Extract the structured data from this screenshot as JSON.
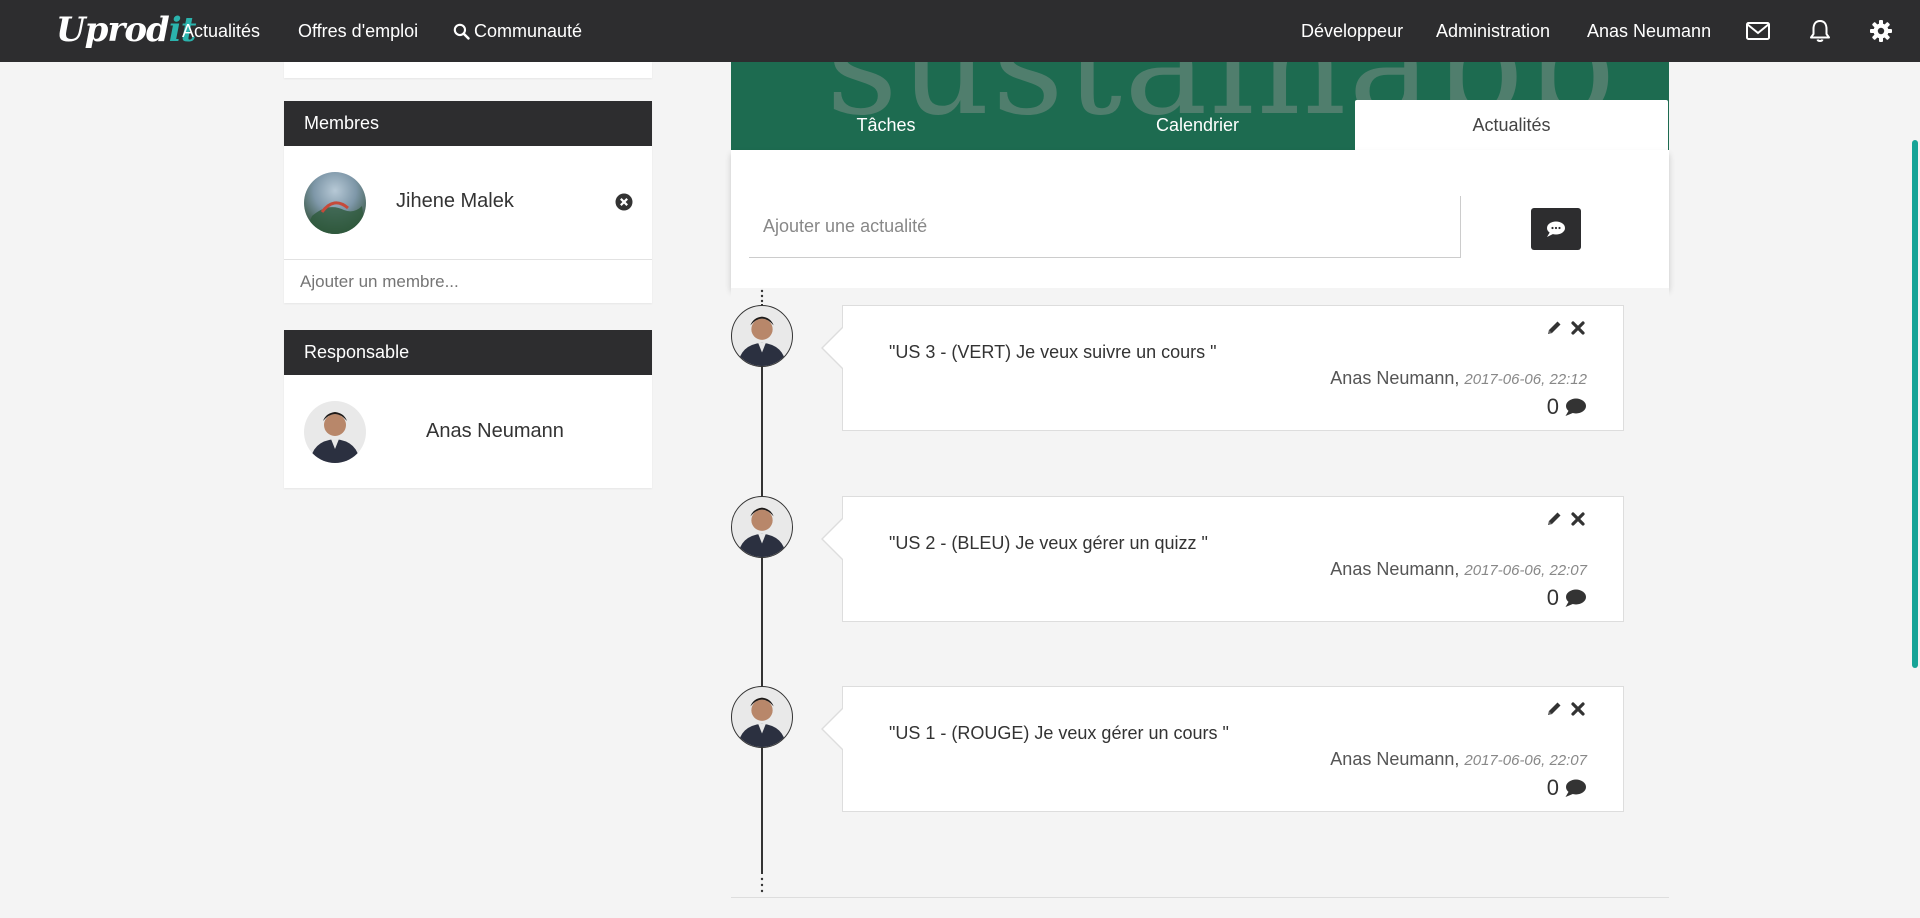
{
  "navbar": {
    "brand_main": "Uprod",
    "brand_accent": "it",
    "links": {
      "actualites": "Actualités",
      "offres": "Offres d'emploi",
      "communaute": "Communauté",
      "developpeur": "Développeur",
      "administration": "Administration",
      "user": "Anas Neumann"
    },
    "icons": [
      "search-icon",
      "envelope-icon",
      "bell-icon",
      "gear-icon"
    ]
  },
  "sidebar": {
    "members": {
      "title": "Membres",
      "items": [
        {
          "name": "Jihene Malek"
        }
      ],
      "add_placeholder": "Ajouter un membre..."
    },
    "responsable": {
      "title": "Responsable",
      "name": "Anas Neumann"
    }
  },
  "project": {
    "banner_text": "sustainapp",
    "tabs": [
      {
        "label": "Tâches",
        "active": false
      },
      {
        "label": "Calendrier",
        "active": false
      },
      {
        "label": "Actualités",
        "active": true
      }
    ]
  },
  "composer": {
    "placeholder": "Ajouter une actualité",
    "send_icon": "comment-icon"
  },
  "posts": [
    {
      "text": "\"US 3 - (VERT) Je veux suivre un cours \"",
      "author": "Anas Neumann,",
      "date": "2017-06-06, 22:12",
      "comments": "0"
    },
    {
      "text": "\"US 2 - (BLEU) Je veux gérer un quizz \"",
      "author": "Anas Neumann,",
      "date": "2017-06-06, 22:07",
      "comments": "0"
    },
    {
      "text": "\"US 1 - (ROUGE) Je veux gérer un cours \"",
      "author": "Anas Neumann,",
      "date": "2017-06-06, 22:07",
      "comments": "0"
    }
  ],
  "colors": {
    "navbar": "#2d2d2f",
    "banner": "#1d6b50",
    "accent": "#2bb3ad",
    "scrollbar": "#16a497"
  }
}
